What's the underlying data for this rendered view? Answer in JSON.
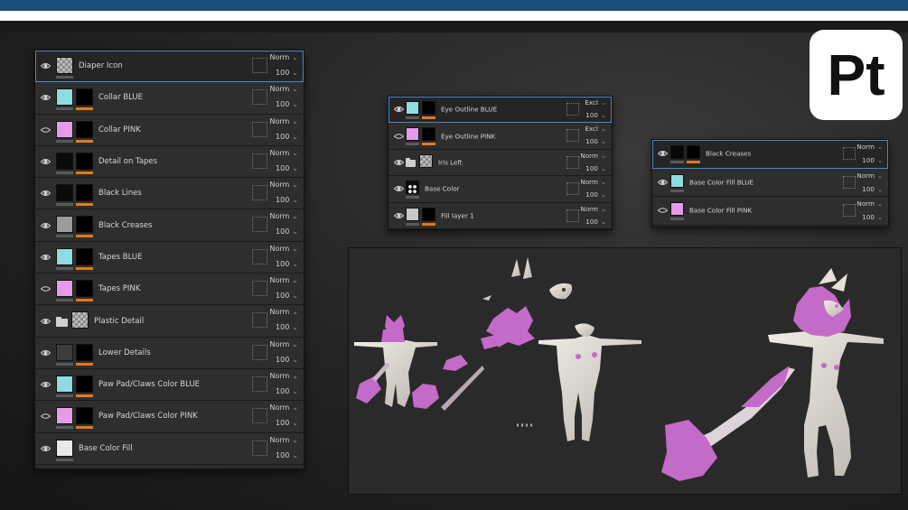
{
  "logo": {
    "text": "Pt",
    "name": "Adobe Substance 3D Painter"
  },
  "colors": {
    "accent_orange": "#e07a1f",
    "selection_blue": "#4f86c6",
    "swatch_blue": "#8fdce0",
    "swatch_pink": "#e69be8",
    "top_bar": "#1c4f78"
  },
  "panel_left": {
    "layers": [
      {
        "name": "Diaper Icon",
        "visible": true,
        "thumb": "checker",
        "mask": false,
        "blend": "Norm",
        "opacity": "100",
        "selected": true
      },
      {
        "name": "Collar BLUE",
        "visible": true,
        "thumb": "blue",
        "mask": true,
        "blend": "Norm",
        "opacity": "100"
      },
      {
        "name": "Collar PINK",
        "visible": false,
        "thumb": "pink",
        "mask": true,
        "blend": "Norm",
        "opacity": "100"
      },
      {
        "name": "Detail on Tapes",
        "visible": true,
        "thumb": "black-fx",
        "mask": true,
        "blend": "Norm",
        "opacity": "100"
      },
      {
        "name": "Black Lines",
        "visible": true,
        "thumb": "black-fx",
        "mask": true,
        "blend": "Norm",
        "opacity": "100"
      },
      {
        "name": "Black Creases",
        "visible": true,
        "thumb": "gray",
        "mask": true,
        "blend": "Norm",
        "opacity": "100"
      },
      {
        "name": "Tapes BLUE",
        "visible": true,
        "thumb": "blue",
        "mask": true,
        "blend": "Norm",
        "opacity": "100"
      },
      {
        "name": "Tapes PINK",
        "visible": false,
        "thumb": "pink",
        "mask": true,
        "blend": "Norm",
        "opacity": "100"
      },
      {
        "name": "Plastic Detail",
        "visible": true,
        "thumb": "folder",
        "mask": false,
        "blend": "Norm",
        "opacity": "100"
      },
      {
        "name": "Lower Details",
        "visible": true,
        "thumb": "darkgray-fx",
        "mask": true,
        "blend": "Norm",
        "opacity": "100"
      },
      {
        "name": "Paw Pad/Claws Color BLUE",
        "visible": true,
        "thumb": "blue",
        "mask": true,
        "blend": "Norm",
        "opacity": "100"
      },
      {
        "name": "Paw Pad/Claws Color PINK",
        "visible": false,
        "thumb": "pink",
        "mask": true,
        "blend": "Norm",
        "opacity": "100"
      },
      {
        "name": "Base Color Fill",
        "visible": true,
        "thumb": "white",
        "mask": false,
        "blend": "Norm",
        "opacity": "100"
      }
    ]
  },
  "panel_mid": {
    "layers": [
      {
        "name": "Eye Outline BLUE",
        "visible": true,
        "thumb": "blue",
        "mask": true,
        "blend": "Excl",
        "opacity": "100",
        "selected": true
      },
      {
        "name": "Eye Outline PINK",
        "visible": false,
        "thumb": "pink",
        "mask": true,
        "blend": "Excl",
        "opacity": "100"
      },
      {
        "name": "Iris Left",
        "visible": true,
        "thumb": "folder",
        "mask": false,
        "blend": "Norm",
        "opacity": "100"
      },
      {
        "name": "Base Color",
        "visible": true,
        "thumb": "dots",
        "mask": false,
        "blend": "Norm",
        "opacity": "100"
      },
      {
        "name": "Fill layer 1",
        "visible": true,
        "thumb": "lightgray",
        "mask": true,
        "blend": "Norm",
        "opacity": "100"
      }
    ]
  },
  "panel_right": {
    "layers": [
      {
        "name": "Black Creases",
        "visible": true,
        "thumb": "black",
        "mask": true,
        "blend": "Norm",
        "opacity": "100",
        "selected": true
      },
      {
        "name": "Base Color Fill BLUE",
        "visible": true,
        "thumb": "blue",
        "mask": false,
        "blend": "Norm",
        "opacity": "100"
      },
      {
        "name": "Base Color Fill PINK",
        "visible": false,
        "thumb": "pink",
        "mask": false,
        "blend": "Norm",
        "opacity": "100"
      }
    ]
  },
  "viewport": {
    "models": [
      "exploded-model-parts",
      "t-pose-body",
      "full-character-render"
    ],
    "colors": {
      "body": "#e2ddd6",
      "fur": "#c46ac8",
      "background": "#2a2a2a"
    }
  }
}
